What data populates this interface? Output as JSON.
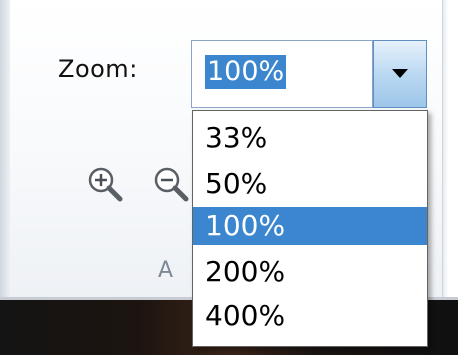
{
  "zoom": {
    "label": "Zoom:",
    "current_value": "100%",
    "options": [
      "33%",
      "50%",
      "100%",
      "200%",
      "400%"
    ],
    "selected_index": 2
  },
  "group": {
    "label": "A"
  },
  "icons": [
    "zoom-in-icon",
    "zoom-out-icon",
    "dropdown-arrow-icon"
  ],
  "colors": {
    "selection": "#3b86cf",
    "ribbon_bg": "#f4f6f8",
    "group_label": "#7e8a98"
  }
}
